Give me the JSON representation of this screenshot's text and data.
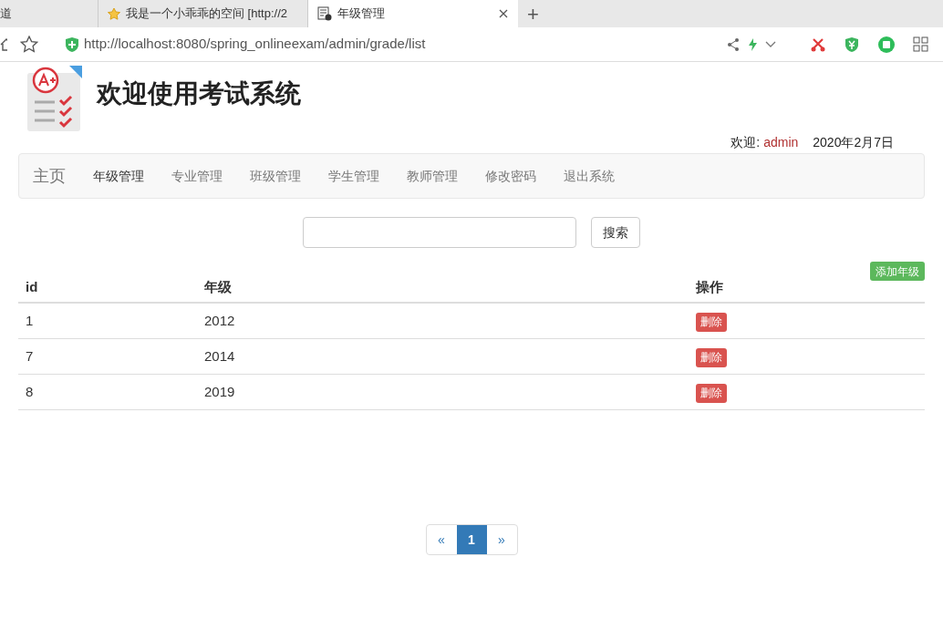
{
  "browser": {
    "tabs": [
      {
        "title": "道",
        "selected": false,
        "closable": false
      },
      {
        "title": "我是一个小乖乖的空间 [http://2",
        "selected": false,
        "closable": false
      },
      {
        "title": "年级管理",
        "selected": true,
        "closable": true
      }
    ],
    "new_tab": "+",
    "url": "http://localhost:8080/spring_onlineexam/admin/grade/list"
  },
  "header": {
    "title": "欢迎使用考试系统",
    "welcome_label": "欢迎:",
    "user": "admin",
    "date": "2020年2月7日"
  },
  "navbar": {
    "brand": "主页",
    "items": [
      {
        "label": "年级管理",
        "selected": true
      },
      {
        "label": "专业管理",
        "selected": false
      },
      {
        "label": "班级管理",
        "selected": false
      },
      {
        "label": "学生管理",
        "selected": false
      },
      {
        "label": "教师管理",
        "selected": false
      },
      {
        "label": "修改密码",
        "selected": false
      },
      {
        "label": "退出系统",
        "selected": false
      }
    ]
  },
  "search": {
    "button": "搜索"
  },
  "add_button": "添加年级",
  "table": {
    "columns": [
      "id",
      "年级",
      "操作"
    ],
    "rows": [
      {
        "id": "1",
        "grade": "2012",
        "action": "删除"
      },
      {
        "id": "7",
        "grade": "2014",
        "action": "删除"
      },
      {
        "id": "8",
        "grade": "2019",
        "action": "删除"
      }
    ]
  },
  "pagination": {
    "prev": "«",
    "pages": [
      {
        "label": "1",
        "selected": true
      }
    ],
    "next": "»"
  }
}
